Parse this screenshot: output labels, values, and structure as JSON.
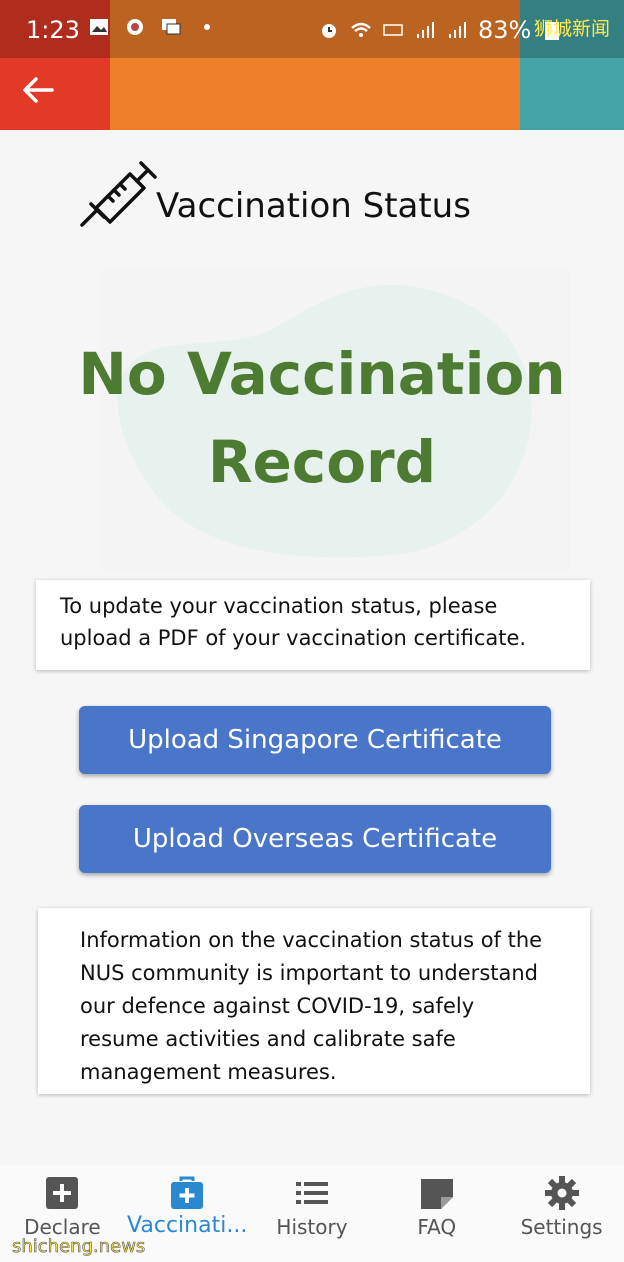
{
  "status_bar": {
    "time": "1:23",
    "battery": "83%"
  },
  "watermark_top": "狮城新闻",
  "watermark_bottom": "shicheng.news",
  "header": {
    "title": "Vaccination Status",
    "icon": "syringe-icon"
  },
  "record_status": "No Vaccination Record",
  "upload_hint": "To update your vaccination status, please upload a PDF of your vaccination certificate.",
  "buttons": {
    "upload_singapore": "Upload Singapore Certificate",
    "upload_overseas": "Upload Overseas Certificate"
  },
  "info_text": "Information on the vaccination status of the NUS community is important to understand our defence against COVID-19, safely resume activities and calibrate safe management measures.",
  "bottom_nav": [
    {
      "label": "Declare",
      "icon": "plus-square-icon",
      "active": false
    },
    {
      "label": "Vaccinati...",
      "icon": "medical-kit-icon",
      "active": true
    },
    {
      "label": "History",
      "icon": "list-icon",
      "active": false
    },
    {
      "label": "FAQ",
      "icon": "note-icon",
      "active": false
    },
    {
      "label": "Settings",
      "icon": "gear-icon",
      "active": false
    }
  ],
  "colors": {
    "status_green": "#4e7b32",
    "button_blue": "#4a76c9",
    "nav_active": "#2a88d1"
  }
}
